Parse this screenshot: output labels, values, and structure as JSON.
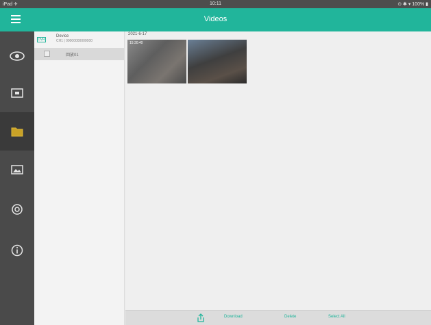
{
  "status_bar": {
    "left": "iPad ✈",
    "time": "10:11",
    "right": "⊙ ✱ ▾ 100% ▮"
  },
  "titlebar": {
    "title": "Videos"
  },
  "sidebar": {
    "items": [
      {
        "icon": "eye-icon",
        "active": false
      },
      {
        "icon": "monitor-icon",
        "active": false
      },
      {
        "icon": "folder-icon",
        "active": true
      },
      {
        "icon": "image-icon",
        "active": false
      },
      {
        "icon": "gear-icon",
        "active": false
      },
      {
        "icon": "info-icon",
        "active": false
      }
    ]
  },
  "device_panel": {
    "device_tag": "DVR",
    "device_name": "Device",
    "device_sub": "CH1 | 00000000000000",
    "channel_label": "回放01"
  },
  "content": {
    "date_label": "2021-6-17",
    "thumbnails": [
      {
        "time": "15:30:40"
      },
      {
        "time": ""
      }
    ]
  },
  "bottom_bar": {
    "buttons": [
      "Download",
      "Delete",
      "Select All"
    ]
  },
  "colors": {
    "accent": "#21b59b",
    "sidebar": "#4a4a4a",
    "status_bar": "#4d4d4d"
  }
}
